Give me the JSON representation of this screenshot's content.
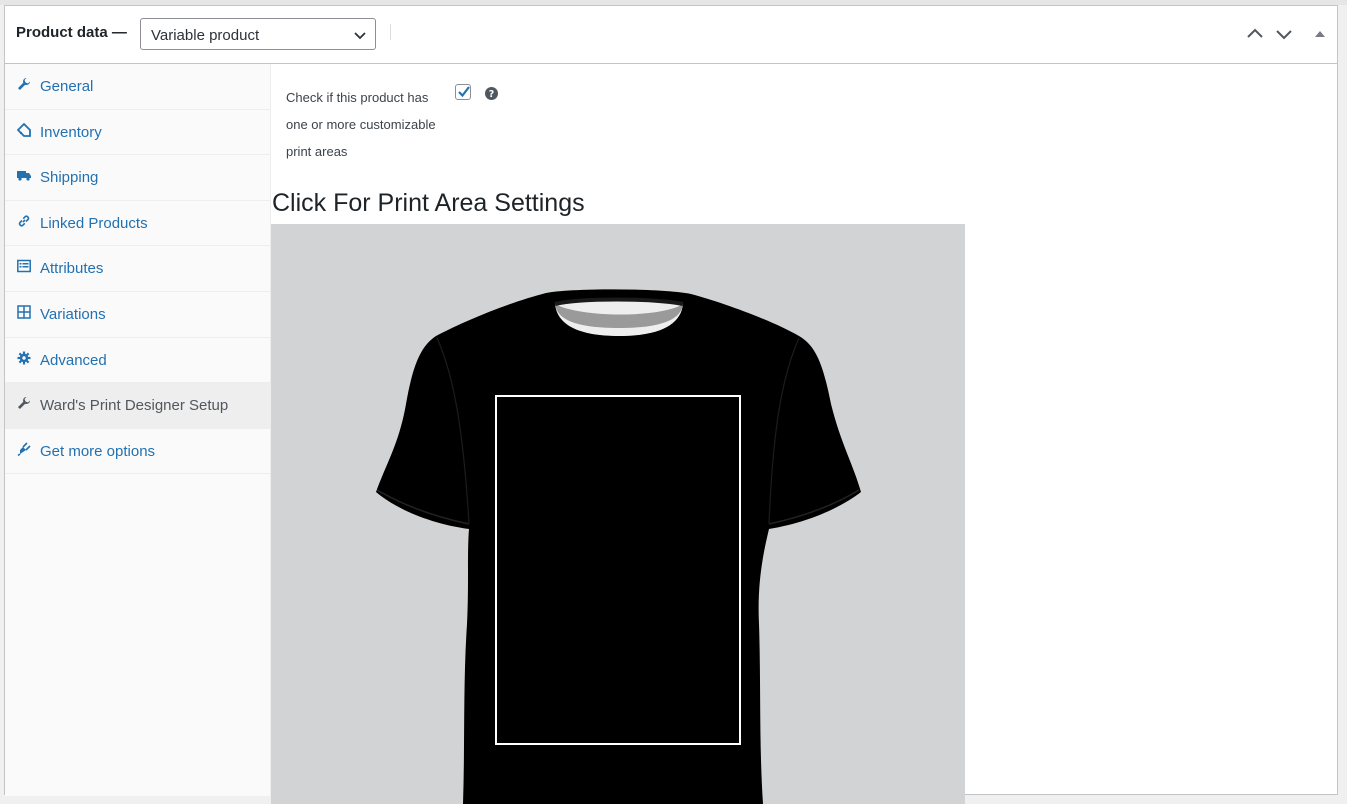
{
  "header": {
    "title": "Product data —",
    "product_type": "Variable product"
  },
  "sidebar": {
    "items": [
      {
        "label": "General",
        "icon": "wrench-icon"
      },
      {
        "label": "Inventory",
        "icon": "tag-icon"
      },
      {
        "label": "Shipping",
        "icon": "truck-icon"
      },
      {
        "label": "Linked Products",
        "icon": "link-icon"
      },
      {
        "label": "Attributes",
        "icon": "list-icon"
      },
      {
        "label": "Variations",
        "icon": "grid-icon"
      },
      {
        "label": "Advanced",
        "icon": "gear-icon"
      },
      {
        "label": "Ward's Print Designer Setup",
        "icon": "wrench-icon",
        "active": true
      },
      {
        "label": "Get more options",
        "icon": "plugin-icon"
      }
    ]
  },
  "main": {
    "checkbox_label_line1": "Check if this product has",
    "checkbox_label_line2": "one or more customizable",
    "checkbox_label_line3": "print areas",
    "checkbox_checked": true,
    "heading": "Click For Print Area Settings"
  },
  "colors": {
    "link": "#2271b1",
    "checkbox_check": "#2271b1",
    "preview_bg": "#d2d3d5",
    "print_area_border": "#ffffff"
  }
}
